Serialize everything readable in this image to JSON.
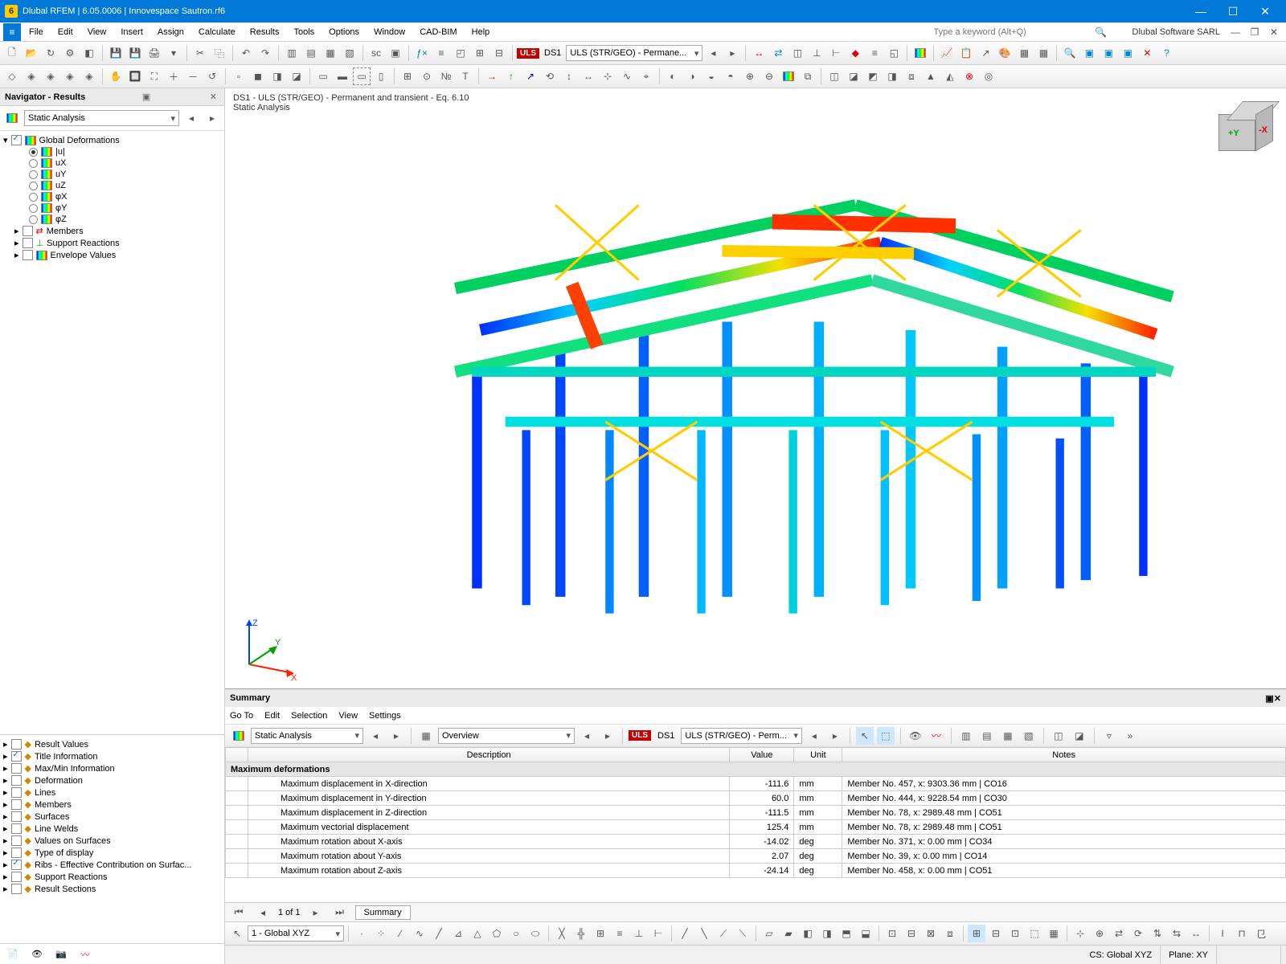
{
  "title": "Dlubal RFEM | 6.05.0006 | Innovespace Sautron.rf6",
  "company": "Dlubal Software SARL",
  "menu": [
    "File",
    "Edit",
    "View",
    "Insert",
    "Assign",
    "Calculate",
    "Results",
    "Tools",
    "Options",
    "Window",
    "CAD-BIM",
    "Help"
  ],
  "search_placeholder": "Type a keyword (Alt+Q)",
  "nav": {
    "header": "Navigator - Results",
    "dropdown": "Static Analysis",
    "tree": {
      "root": "Global Deformations",
      "radios": [
        "|u|",
        "uX",
        "uY",
        "uZ",
        "φX",
        "φY",
        "φZ"
      ],
      "selected": 0,
      "siblings": [
        "Members",
        "Support Reactions",
        "Envelope Values"
      ]
    },
    "options": [
      {
        "label": "Result Values",
        "checked": false
      },
      {
        "label": "Title Information",
        "checked": true
      },
      {
        "label": "Max/Min Information",
        "checked": false
      },
      {
        "label": "Deformation",
        "checked": false
      },
      {
        "label": "Lines",
        "checked": false
      },
      {
        "label": "Members",
        "checked": false
      },
      {
        "label": "Surfaces",
        "checked": false
      },
      {
        "label": "Line Welds",
        "checked": false
      },
      {
        "label": "Values on Surfaces",
        "checked": false
      },
      {
        "label": "Type of display",
        "checked": false
      },
      {
        "label": "Ribs - Effective Contribution on Surfac...",
        "checked": true
      },
      {
        "label": "Support Reactions",
        "checked": false
      },
      {
        "label": "Result Sections",
        "checked": false
      }
    ]
  },
  "view": {
    "line1": "DS1 - ULS (STR/GEO) - Permanent and transient - Eq. 6.10",
    "line2": "Static Analysis"
  },
  "tool2": {
    "uls": "ULS",
    "ds": "DS1",
    "combo": "ULS (STR/GEO) - Permane..."
  },
  "summary": {
    "title": "Summary",
    "menu": [
      "Go To",
      "Edit",
      "Selection",
      "View",
      "Settings"
    ],
    "tool": {
      "drop1": "Static Analysis",
      "drop2": "Overview",
      "uls": "ULS",
      "ds": "DS1",
      "combo": "ULS (STR/GEO) - Perm..."
    },
    "headers": [
      "Description",
      "Value",
      "Unit",
      "Notes"
    ],
    "group": "Maximum deformations",
    "rows": [
      {
        "d": "Maximum displacement in X-direction",
        "v": "-111.6",
        "u": "mm",
        "n": "Member No. 457, x: 9303.36 mm | CO16"
      },
      {
        "d": "Maximum displacement in Y-direction",
        "v": "60.0",
        "u": "mm",
        "n": "Member No. 444, x: 9228.54 mm | CO30"
      },
      {
        "d": "Maximum displacement in Z-direction",
        "v": "-111.5",
        "u": "mm",
        "n": "Member No. 78, x: 2989.48 mm | CO51"
      },
      {
        "d": "Maximum vectorial displacement",
        "v": "125.4",
        "u": "mm",
        "n": "Member No. 78, x: 2989.48 mm | CO51"
      },
      {
        "d": "Maximum rotation about X-axis",
        "v": "-14.02",
        "u": "deg",
        "n": "Member No. 371, x: 0.00 mm | CO34"
      },
      {
        "d": "Maximum rotation about Y-axis",
        "v": "2.07",
        "u": "deg",
        "n": "Member No. 39, x: 0.00 mm | CO14"
      },
      {
        "d": "Maximum rotation about Z-axis",
        "v": "-24.14",
        "u": "deg",
        "n": "Member No. 458, x: 0.00 mm | CO51"
      }
    ],
    "pager": "1 of 1",
    "tab": "Summary"
  },
  "status": {
    "cs_label": "1 - Global XYZ",
    "cs": "CS: Global XYZ",
    "plane": "Plane: XY"
  }
}
